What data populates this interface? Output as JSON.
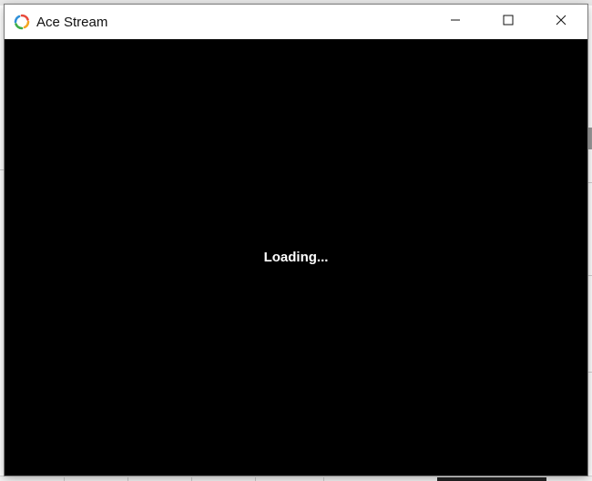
{
  "window": {
    "title": "Ace Stream",
    "icon": "ace-stream-logo-icon",
    "controls": {
      "minimize": "minimize-icon",
      "maximize": "maximize-icon",
      "close": "close-icon"
    }
  },
  "player": {
    "status_text": "Loading..."
  }
}
